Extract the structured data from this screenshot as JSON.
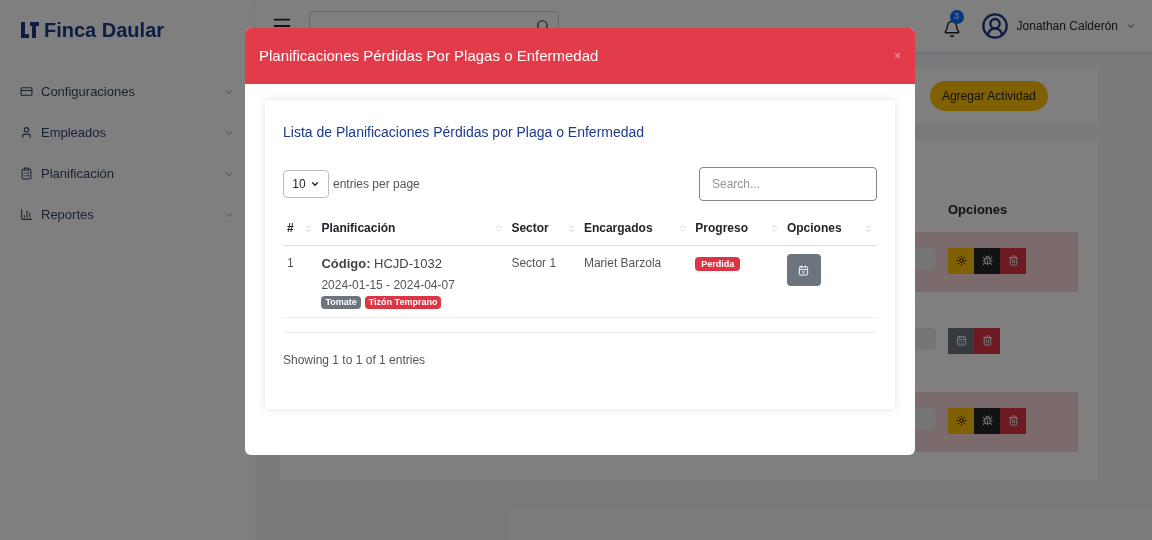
{
  "brand": {
    "name": "Finca Daular"
  },
  "sidebar": {
    "items": [
      {
        "label": "Configuraciones",
        "kind": "config"
      },
      {
        "label": "Empleados",
        "kind": "people"
      },
      {
        "label": "Planificación",
        "kind": "plan"
      },
      {
        "label": "Reportes",
        "kind": "reports"
      }
    ]
  },
  "topbar": {
    "notifications": "3",
    "user": "Jonathan Calderón"
  },
  "background": {
    "add_button": "Agregar Actividad",
    "options_header": "Opciones",
    "rows": [
      {
        "highlighted": true,
        "buttons": [
          {
            "kind": "settings"
          },
          {
            "kind": "bug"
          },
          {
            "kind": "delete"
          }
        ]
      },
      {
        "highlighted": false,
        "buttons": [
          {
            "kind": "calendar"
          },
          {
            "kind": "delete"
          }
        ]
      },
      {
        "highlighted": true,
        "buttons": [
          {
            "kind": "settings"
          },
          {
            "kind": "bug"
          },
          {
            "kind": "delete"
          }
        ]
      }
    ]
  },
  "modal": {
    "title": "Planificaciones Pérdidas Por Plagas o Enfermedad",
    "close": "×",
    "card_title": "Lista de Planificaciones Pérdidas por Plaga o Enfermedad",
    "page_size": "10",
    "page_size_label": "entries per page",
    "search_placeholder": "Search...",
    "columns": [
      "#",
      "Planificación",
      "Sector",
      "Encargados",
      "Progreso",
      "Opciones"
    ],
    "rows": [
      {
        "number": "1",
        "code": "**Código:** HCJD-1032",
        "dates": "2024-01-15 - 2024-04-07",
        "tags": [
          {
            "label": "Tomate",
            "color": "#6c757d"
          },
          {
            "label": "Tizón Temprano",
            "color": "#dc3545"
          }
        ],
        "sector": "Sector 1",
        "manager": "Mariet Barzola",
        "progress": {
          "label": "Perdida",
          "color": "#dc3545"
        }
      }
    ],
    "footer": "Showing 1 to 1 of 1 entries"
  }
}
